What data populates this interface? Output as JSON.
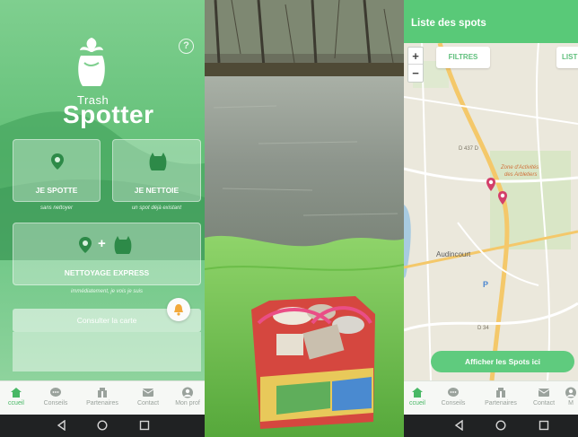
{
  "left_app": {
    "help_glyph": "?",
    "logo": {
      "top": "Trash",
      "main": "Spotter"
    },
    "actions": {
      "spot": {
        "label": "JE SPOTTE",
        "subtitle": "sans nettoyer"
      },
      "clean": {
        "label": "JE NETTOIE",
        "subtitle": "un spot déjà existant"
      },
      "express": {
        "label": "NETTOYAGE EXPRESS",
        "plus": "+",
        "subtitle": "immédiatement, je vois je suis"
      }
    },
    "consult_label": "Consulter la carte",
    "tabs": [
      "ccueil",
      "Conseils",
      "Partenaires",
      "Contact",
      "Mon prof"
    ],
    "colors": {
      "brand_green": "#5cc274",
      "white": "#ffffff"
    }
  },
  "right_app": {
    "header_title": "Liste des spots",
    "zoom_in": "+",
    "zoom_out": "−",
    "filters_label": "FILTRES",
    "list_label": "LIST",
    "map_labels": {
      "zone": "Zone d'Activités",
      "zone2": "des Arbletiers",
      "city": "Audincourt",
      "road1": "D 437 D",
      "road2": "D 34",
      "parking": "P"
    },
    "show_button": "Afficher les Spots ici",
    "tabs": [
      "ccueil",
      "Conseils",
      "Partenaires",
      "Contact",
      "M"
    ]
  }
}
